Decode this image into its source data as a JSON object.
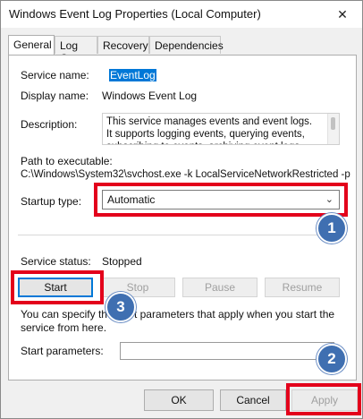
{
  "window": {
    "title": "Windows Event Log Properties (Local Computer)",
    "close_glyph": "✕"
  },
  "tabs": [
    {
      "label": "General"
    },
    {
      "label": "Log On"
    },
    {
      "label": "Recovery"
    },
    {
      "label": "Dependencies"
    }
  ],
  "general": {
    "service_name_label": "Service name:",
    "service_name_value": "EventLog",
    "display_name_label": "Display name:",
    "display_name_value": "Windows Event Log",
    "description_label": "Description:",
    "description_value": "This service manages events and event logs. It supports logging events, querying events, subscribing to events, archiving event logs, and",
    "path_label": "Path to executable:",
    "path_value": "C:\\Windows\\System32\\svchost.exe -k LocalServiceNetworkRestricted -p",
    "startup_type_label": "Startup type:",
    "startup_type_value": "Automatic",
    "service_status_label": "Service status:",
    "service_status_value": "Stopped",
    "buttons": {
      "start": "Start",
      "stop": "Stop",
      "pause": "Pause",
      "resume": "Resume"
    },
    "help_text": "You can specify the start parameters that apply when you start the service from here.",
    "start_params_label": "Start parameters:",
    "start_params_value": ""
  },
  "footer": {
    "ok": "OK",
    "cancel": "Cancel",
    "apply": "Apply"
  },
  "annotations": {
    "badge_1": "1",
    "badge_2": "2",
    "badge_3": "3",
    "highlight_color": "#e3001b",
    "badge_color": "#3f6fb1"
  }
}
